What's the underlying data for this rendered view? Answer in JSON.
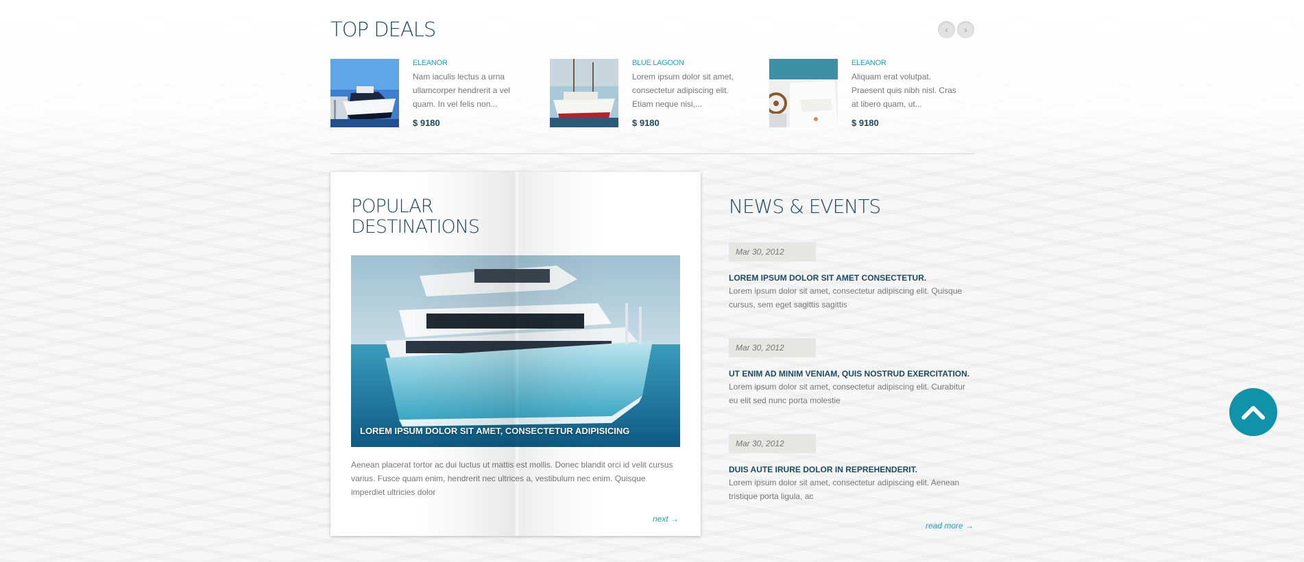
{
  "top_deals": {
    "title": "TOP DEALS",
    "prev_icon": "chevron-left-icon",
    "next_icon": "chevron-right-icon",
    "items": [
      {
        "name": "ELEANOR",
        "description": "Nam iaculis lectus a urna ullamcorper hendrerit a vel quam. In vel felis non...",
        "price": "$ 9180"
      },
      {
        "name": "BLUE LAGOON",
        "description": "Lorem ipsum dolor sit amet, consectetur adipiscing elit. Etiam neque nisi,...",
        "price": "$ 9180"
      },
      {
        "name": "ELEANOR",
        "description": "Aliquam erat volutpat. Praesent quis nibh nisl. Cras at libero quam, ut...",
        "price": "$ 9180"
      }
    ]
  },
  "popular": {
    "title": "POPULAR DESTINATIONS",
    "caption": "LOREM IPSUM DOLOR SIT AMET, CONSECTETUR ADIPISICING",
    "text": "Aenean placerat tortor ac dui luctus ut mattis est mollis. Donec blandit orci id velit cursus varius. Fusce quam enim, hendrerit nec ultrices a, vestibulum nec enim. Quisque imperdiet ultricies dolor",
    "next_label": "next →"
  },
  "news": {
    "title": "NEWS & EVENTS",
    "items": [
      {
        "date": "Mar 30, 2012",
        "heading": "LOREM IPSUM DOLOR SIT AMET CONSECTETUR.",
        "text": "Lorem ipsum dolor sit amet, consectetur adipiscing elit. Quisque cursus, sem eget sagittis sagittis"
      },
      {
        "date": "Mar 30, 2012",
        "heading": "UT ENIM AD MINIM VENIAM, QUIS NOSTRUD EXERCITATION.",
        "text": "Lorem ipsum dolor sit amet, consectetur adipiscing elit. Curabitur eu elit sed nunc porta molestie"
      },
      {
        "date": "Mar 30, 2012",
        "heading": "DUIS AUTE IRURE DOLOR IN REPREHENDERIT.",
        "text": "Lorem ipsum dolor sit amet, consectetur adipiscing elit. Aenean tristique porta ligula, ac"
      }
    ],
    "read_more_label": "read more →"
  },
  "scroll_top_icon": "chevron-up-icon",
  "colors": {
    "accent": "#1aa6c6",
    "heading": "#1b4a66",
    "scroll_button": "#0e93a8"
  }
}
